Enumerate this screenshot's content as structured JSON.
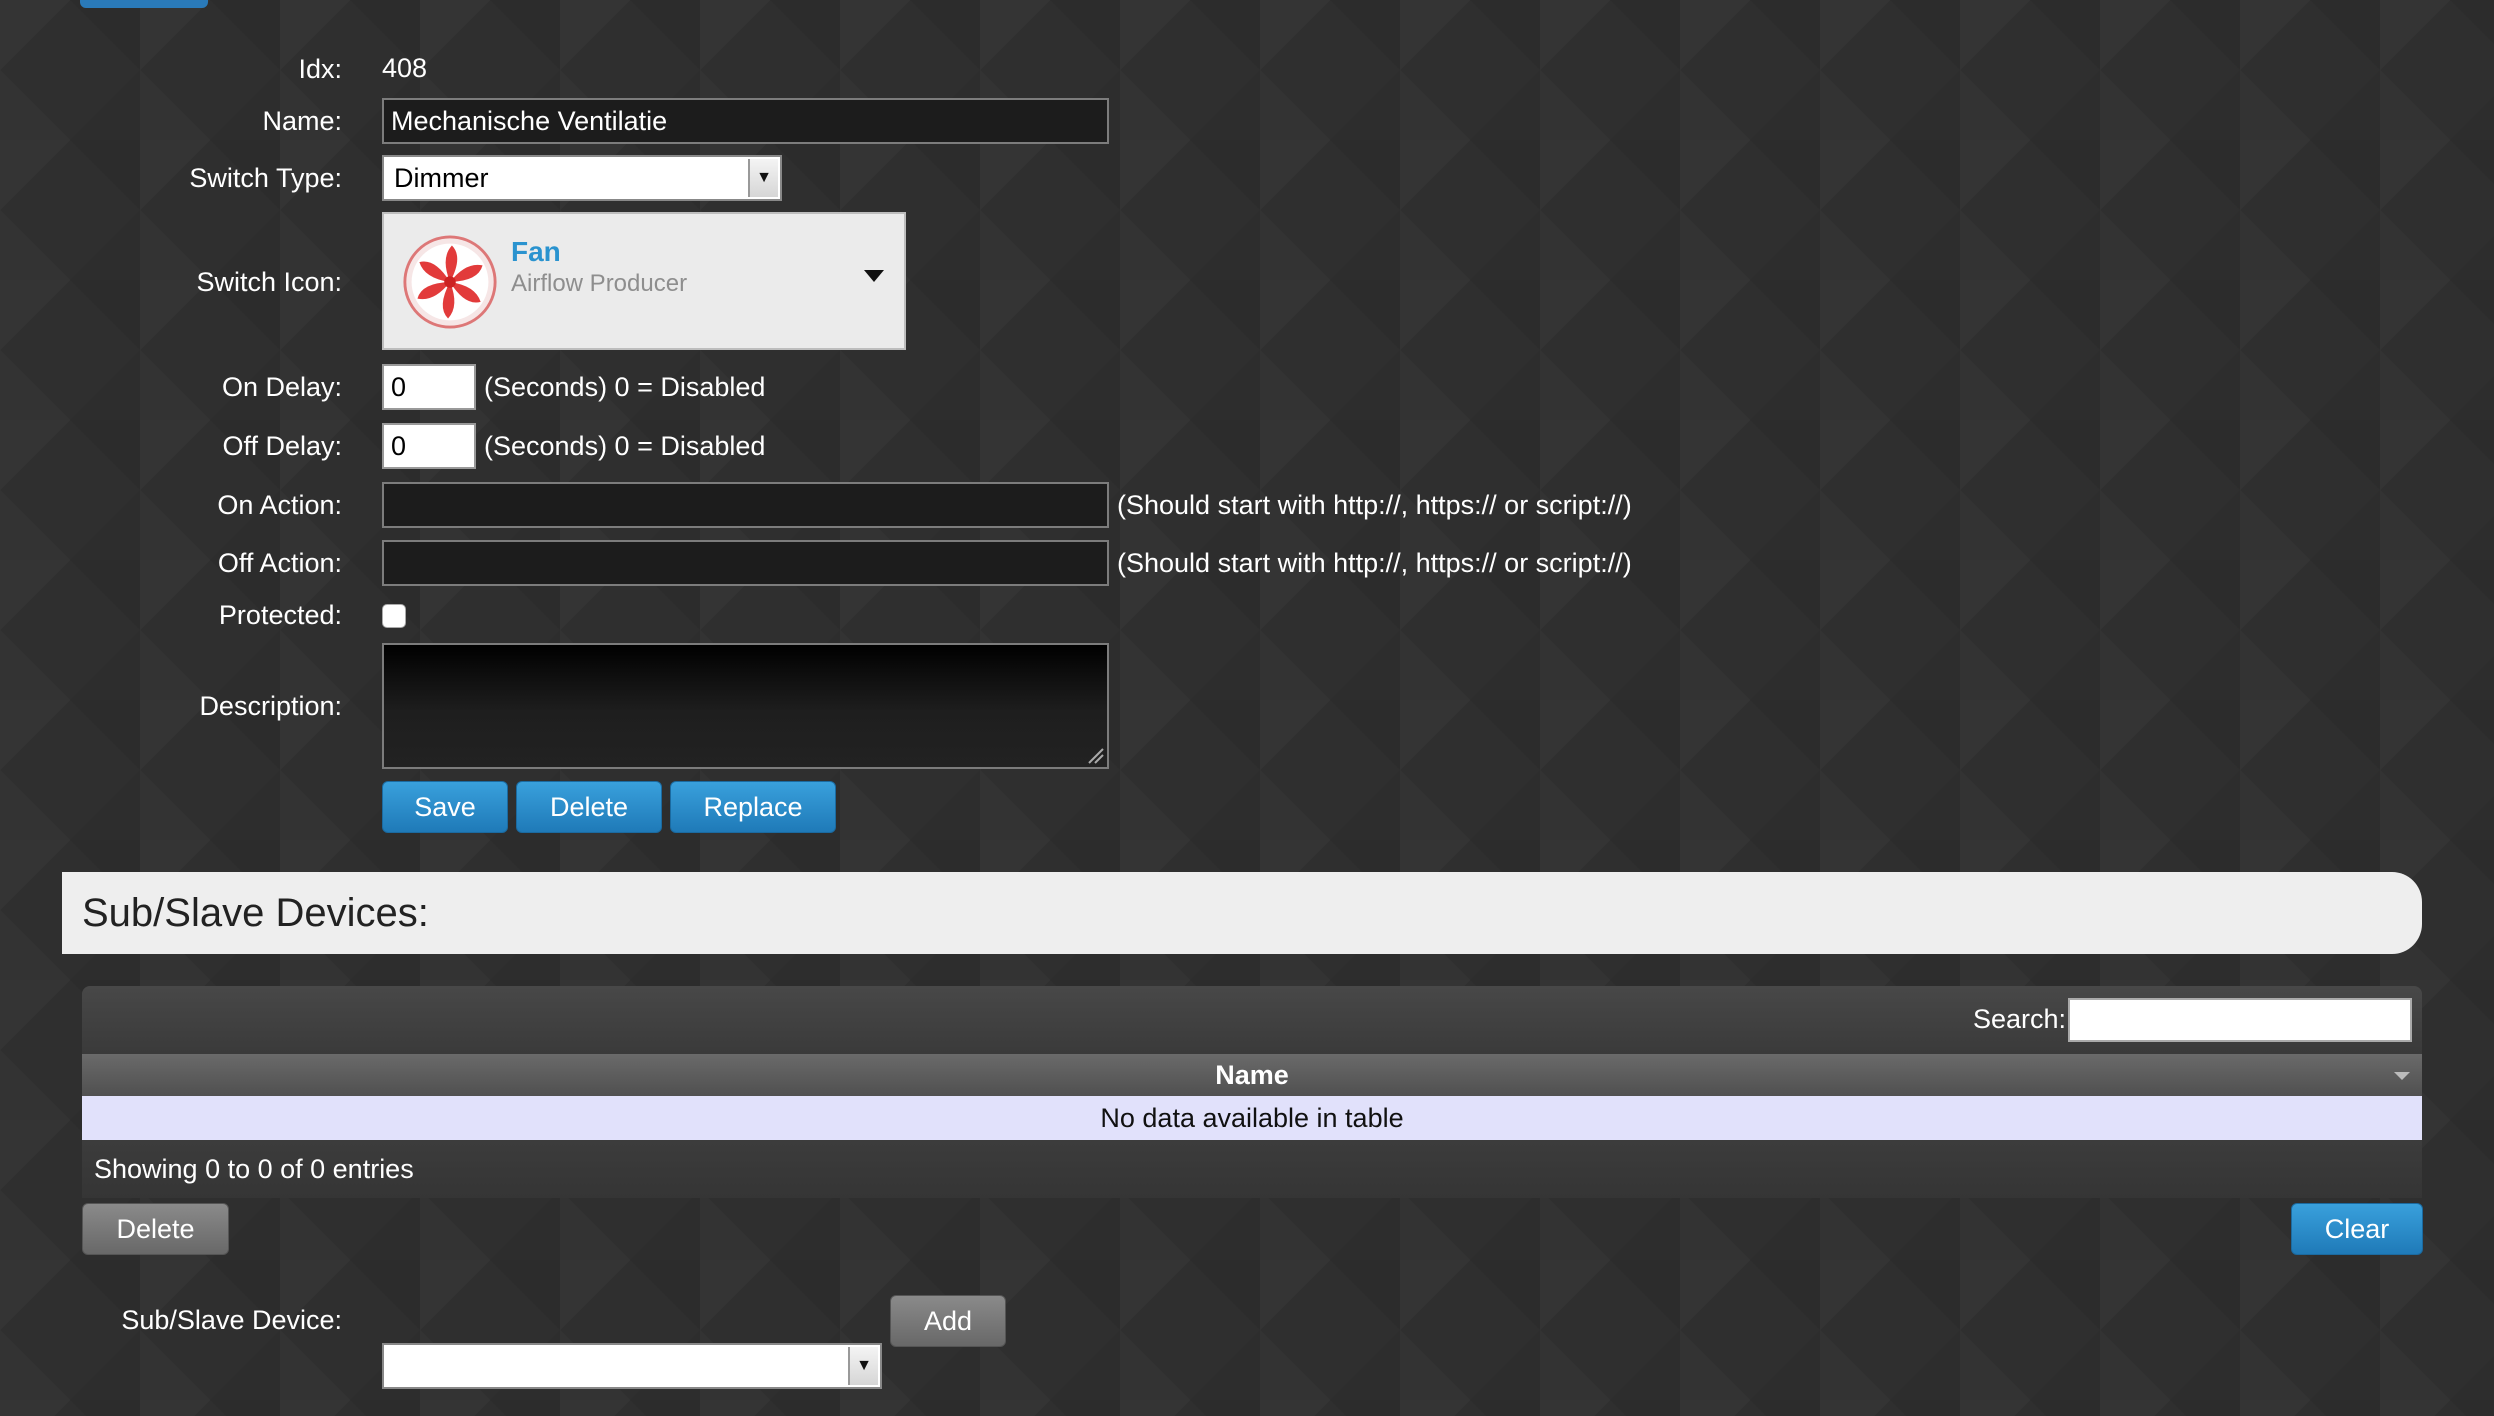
{
  "form": {
    "idx_label": "Idx:",
    "idx_value": "408",
    "name_label": "Name:",
    "name_value": "Mechanische Ventilatie",
    "switch_type_label": "Switch Type:",
    "switch_type_value": "Dimmer",
    "switch_icon_label": "Switch Icon:",
    "switch_icon": {
      "title": "Fan",
      "subtitle": "Airflow Producer",
      "icon": "fan-icon"
    },
    "on_delay_label": "On Delay:",
    "on_delay_value": "0",
    "on_delay_hint": "(Seconds) 0 = Disabled",
    "off_delay_label": "Off Delay:",
    "off_delay_value": "0",
    "off_delay_hint": "(Seconds) 0 = Disabled",
    "on_action_label": "On Action:",
    "on_action_value": "",
    "on_action_hint": "(Should start with http://, https:// or script://)",
    "off_action_label": "Off Action:",
    "off_action_value": "",
    "off_action_hint": "(Should start with http://, https:// or script://)",
    "protected_label": "Protected:",
    "protected_checked": false,
    "description_label": "Description:",
    "description_value": ""
  },
  "buttons": {
    "save": "Save",
    "delete": "Delete",
    "replace": "Replace"
  },
  "subslave": {
    "section_title": "Sub/Slave Devices:",
    "search_label": "Search:",
    "search_value": "",
    "column_name": "Name",
    "empty_message": "No data available in table",
    "info": "Showing 0 to 0 of 0 entries",
    "delete_button": "Delete",
    "clear_button": "Clear",
    "device_label": "Sub/Slave Device:",
    "device_value": "",
    "add_button": "Add"
  },
  "colors": {
    "accent": "#2a93cf",
    "button_blue": "#2a7ab9",
    "button_grey": "#777777",
    "empty_row": "#e1e1fb",
    "fan_red": "#e23b3b"
  }
}
